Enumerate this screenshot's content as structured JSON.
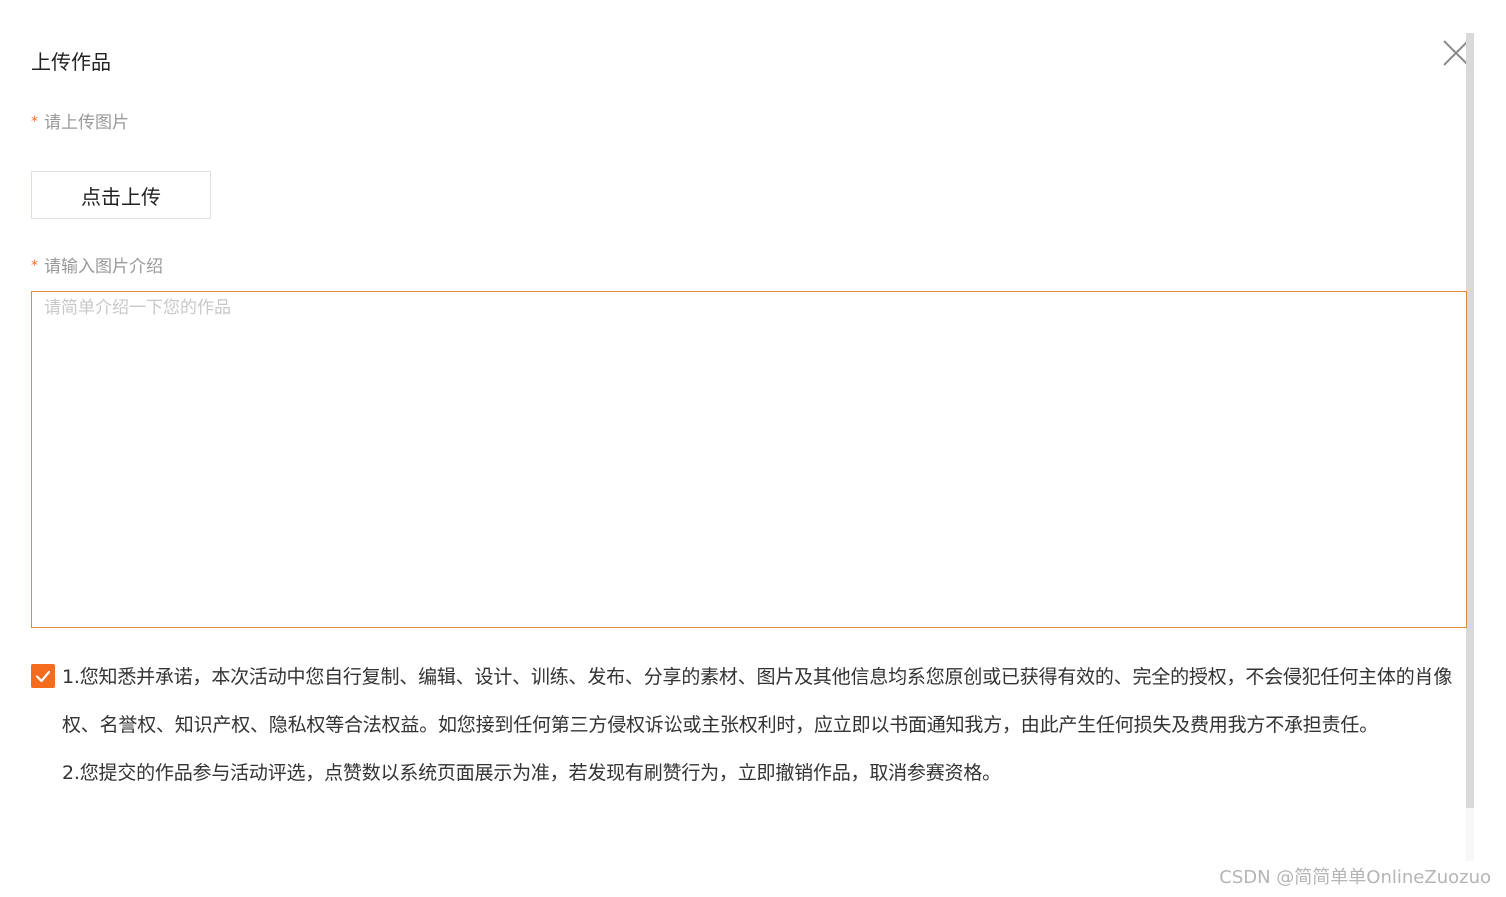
{
  "dialog": {
    "title": "上传作品",
    "close_icon": "close-icon"
  },
  "image_field": {
    "required_mark": "*",
    "label": "请上传图片",
    "upload_button": "点击上传"
  },
  "description_field": {
    "required_mark": "*",
    "label": "请输入图片介绍",
    "value": "",
    "placeholder": "请简单介绍一下您的作品"
  },
  "agreement": {
    "checked": true,
    "check_icon": "checkmark-icon",
    "terms": [
      "1.您知悉并承诺，本次活动中您自行复制、编辑、设计、训练、发布、分享的素材、图片及其他信息均系您原创或已获得有效的、完全的授权，不会侵犯任何主体的肖像权、名誉权、知识产权、隐私权等合法权益。如您接到任何第三方侵权诉讼或主张权利时，应立即以书面通知我方，由此产生任何损失及费用我方不承担责任。",
      "2.您提交的作品参与活动评选，点赞数以系统页面展示为准，若发现有刷赞行为，立即撤销作品，取消参赛资格。"
    ]
  },
  "watermark": "CSDN @简简单单OnlineZuozuo",
  "colors": {
    "accent": "#f56c1f",
    "textarea_border": "#e08a3c",
    "label_gray": "#999999"
  }
}
